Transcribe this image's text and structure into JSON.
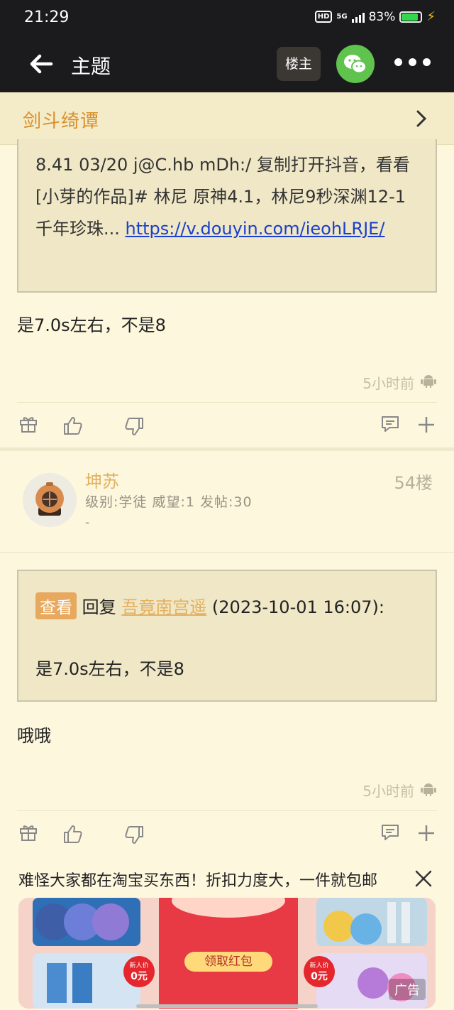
{
  "status": {
    "time": "21:29",
    "hd": "HD",
    "network": "5G",
    "battery": "83%"
  },
  "appbar": {
    "title": "主题",
    "op_button": "楼主"
  },
  "forum": {
    "name": "剑斗绮谭"
  },
  "post1": {
    "quote_text": "8.41 03/20 j@C.hb mDh:/ 复制打开抖音，看看[小芽的作品]# 林尼 原神4.1，林尼9秒深渊12-1千年珍珠... ",
    "quote_link": "https://v.douyin.com/ieohLRJE/",
    "body": "是7.0s左右，不是8",
    "time_ago": "5小时前"
  },
  "post2": {
    "user": "坤苏",
    "meta": "级别:学徒 威望:1 发帖:30",
    "dash": "-",
    "floor": "54楼",
    "quote_tag": "查看",
    "quote_reply": "回复",
    "quote_user": "吾竟南宫遥",
    "quote_date": "(2023-10-01 16:07):",
    "quote_body": "是7.0s左右，不是8",
    "body": "哦哦",
    "time_ago": "5小时前"
  },
  "ad": {
    "text": "难怪大家都在淘宝买东西！折扣力度大，一件就包邮",
    "button": "领取红包",
    "badge_new": "新人价",
    "badge_price": "0元",
    "label": "广告"
  }
}
